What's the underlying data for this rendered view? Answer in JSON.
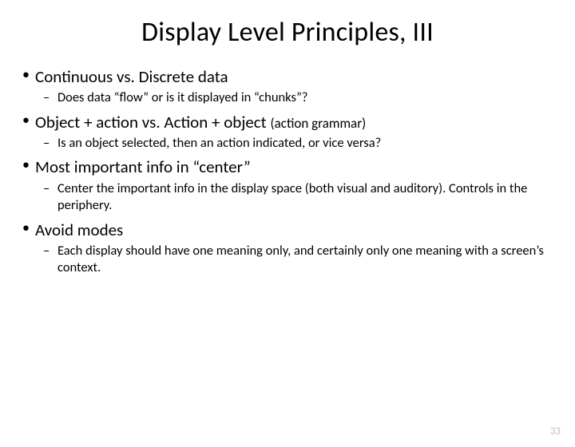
{
  "title": "Display Level Principles, III",
  "bullets": {
    "b0": {
      "text": "Continuous vs. Discrete data",
      "sub": "Does data “flow” or is it displayed in “chunks”?"
    },
    "b1": {
      "text": "Object + action vs. Action + object ",
      "paren": "(action grammar)",
      "sub": "Is an object selected, then an action indicated, or vice versa?"
    },
    "b2": {
      "text": "Most important info in “center”",
      "sub": "Center the important info in the display space (both visual and auditory). Controls in the periphery."
    },
    "b3": {
      "text": "Avoid modes",
      "sub": "Each display should have one meaning only, and certainly only one meaning with a screen’s context."
    }
  },
  "page_number": "33"
}
